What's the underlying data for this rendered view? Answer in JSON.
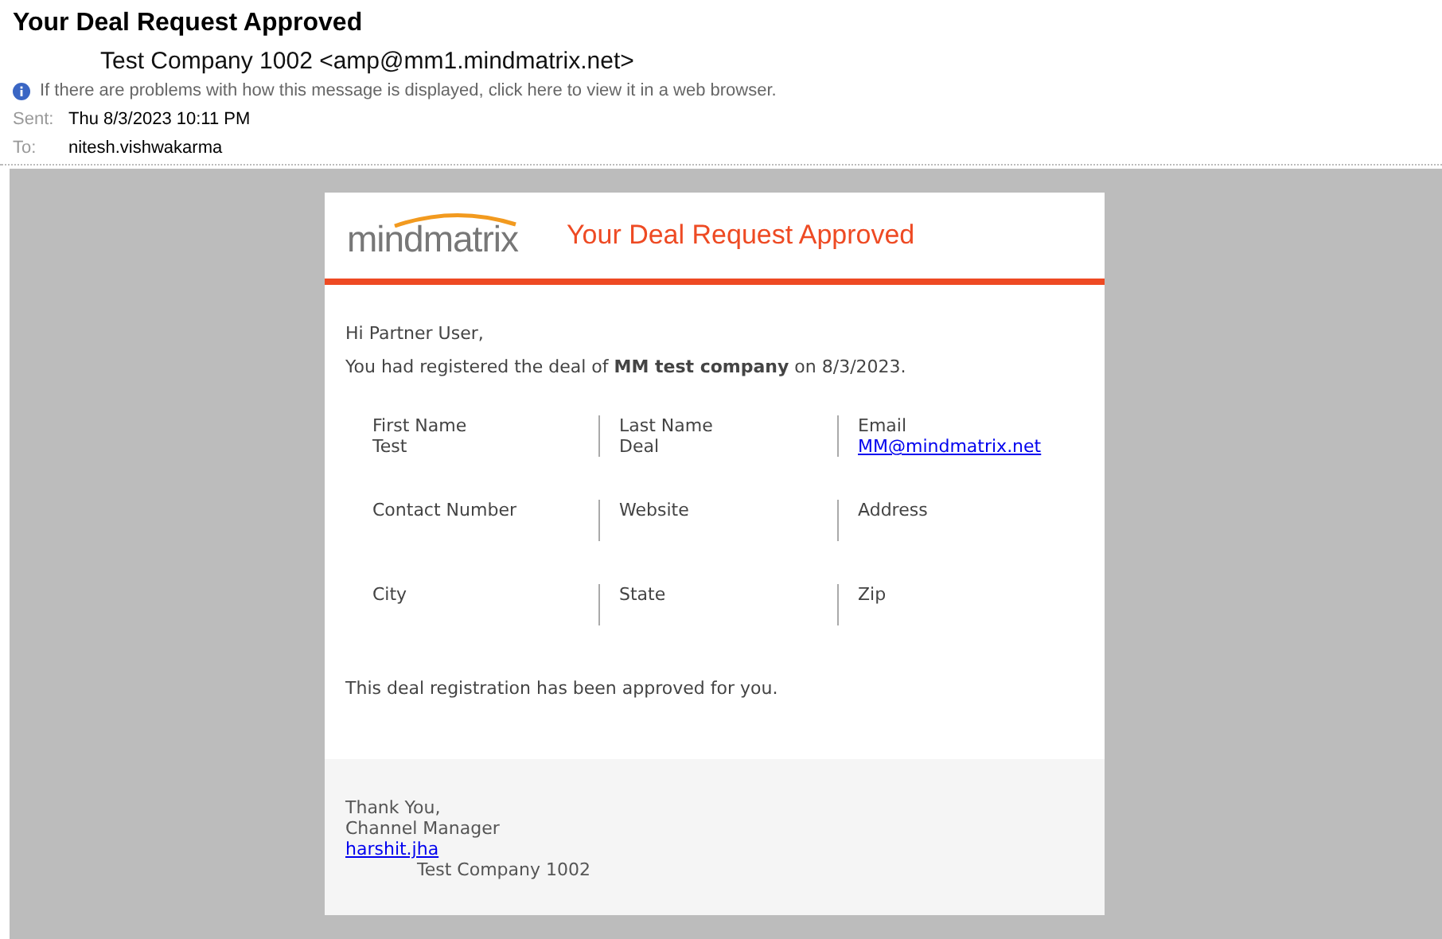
{
  "message": {
    "subject": "Your Deal Request Approved",
    "sender": "Test Company 1002 <amp@mm1.mindmatrix.net>",
    "info_bar": "If there are problems with how this message is displayed, click here to view it in a web browser.",
    "sent_label": "Sent:",
    "sent": "Thu 8/3/2023 10:11 PM",
    "to_label": "To:",
    "to": "nitesh.vishwakarma"
  },
  "email": {
    "logo": "mindmatrix",
    "title": "Your Deal Request Approved",
    "greeting": "Hi Partner User,",
    "intro": "You had registered the deal of **MM test company** on 8/3/2023.",
    "fields": [
      {
        "label": "First Name",
        "value": "Test",
        "kind": "text"
      },
      {
        "label": "Last Name",
        "value": "Deal",
        "kind": "text"
      },
      {
        "label": "Email",
        "value": "MM@mindmatrix.net",
        "kind": "link"
      },
      {
        "label": "Contact Number"
      },
      {
        "label": "Website"
      },
      {
        "label": "Address"
      },
      {
        "label": "City"
      },
      {
        "label": "State"
      },
      {
        "label": "Zip"
      }
    ],
    "approval": "This deal registration has been approved for you.",
    "signature": {
      "closing": "Thank You,",
      "role": "Channel Manager",
      "email": "harshit.jha",
      "company": "Test Company 1002"
    }
  }
}
